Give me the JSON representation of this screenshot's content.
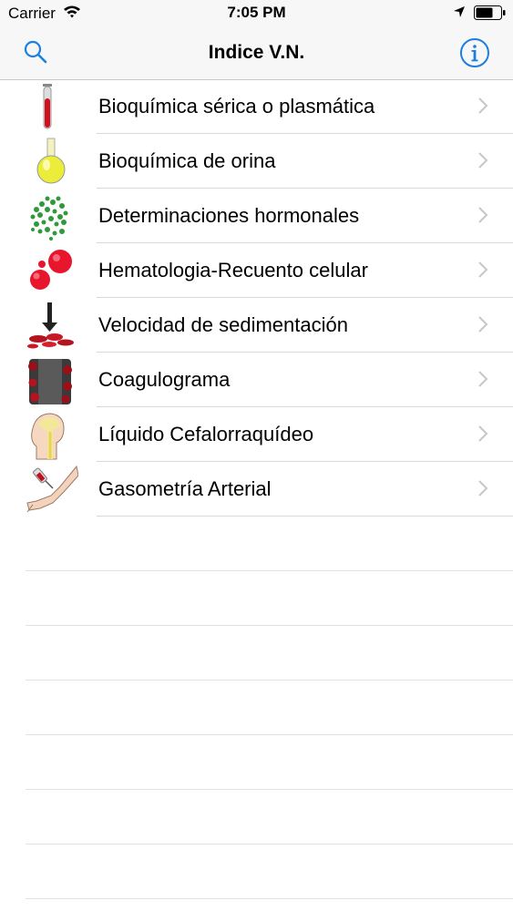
{
  "status_bar": {
    "carrier": "Carrier",
    "time": "7:05 PM"
  },
  "nav": {
    "title": "Indice V.N."
  },
  "items": [
    {
      "label": "Bioquímica sérica o plasmática",
      "icon": "blood-tube-icon"
    },
    {
      "label": "Bioquímica de orina",
      "icon": "urine-flask-icon"
    },
    {
      "label": "Determinaciones hormonales",
      "icon": "hormone-dots-icon"
    },
    {
      "label": "Hematologia-Recuento celular",
      "icon": "blood-cells-icon"
    },
    {
      "label": "Velocidad de sedimentación",
      "icon": "sedimentation-icon"
    },
    {
      "label": "Coagulograma",
      "icon": "coagulation-icon"
    },
    {
      "label": "Líquido Cefalorraquídeo",
      "icon": "spinal-fluid-icon"
    },
    {
      "label": "Gasometría Arterial",
      "icon": "arterial-blood-gas-icon"
    }
  ],
  "colors": {
    "accent": "#1a7fe0",
    "chevron": "#c7c7cc",
    "separator": "#d9d9dd"
  }
}
